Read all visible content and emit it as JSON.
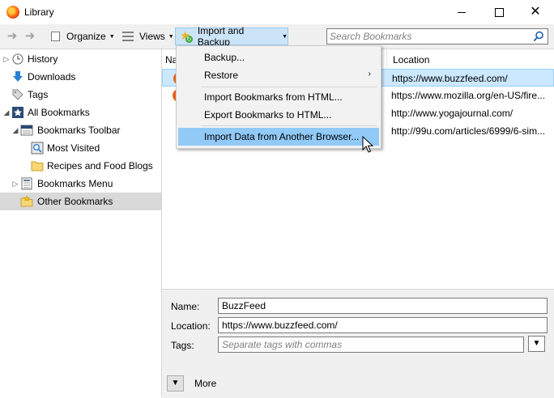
{
  "window": {
    "title": "Library"
  },
  "toolbar": {
    "organize_label": "Organize",
    "views_label": "Views",
    "import_backup_label": "Import and Backup",
    "search_placeholder": "Search Bookmarks"
  },
  "sidebar": {
    "items": [
      {
        "label": "History",
        "icon": "history-icon"
      },
      {
        "label": "Downloads",
        "icon": "downloads-icon"
      },
      {
        "label": "Tags",
        "icon": "tags-icon"
      },
      {
        "label": "All Bookmarks",
        "icon": "all-bookmarks-icon"
      },
      {
        "label": "Bookmarks Toolbar",
        "icon": "bookmarks-toolbar-icon"
      },
      {
        "label": "Most Visited",
        "icon": "smart-folder-icon"
      },
      {
        "label": "Recipes and Food Blogs",
        "icon": "folder-icon"
      },
      {
        "label": "Bookmarks Menu",
        "icon": "bookmarks-menu-icon"
      },
      {
        "label": "Other Bookmarks",
        "icon": "other-bookmarks-icon"
      }
    ],
    "selected": "Other Bookmarks"
  },
  "list": {
    "columns": [
      "Na",
      "Location"
    ],
    "rows": [
      {
        "location": "https://www.buzzfeed.com/"
      },
      {
        "location": "https://www.mozilla.org/en-US/fire..."
      },
      {
        "location": "http://www.yogajournal.com/"
      },
      {
        "location": "http://99u.com/articles/6999/6-sim..."
      }
    ]
  },
  "menu": {
    "items": [
      {
        "label": "Backup...",
        "accel": "B"
      },
      {
        "label": "Restore",
        "accel": "R"
      },
      {
        "label": "Import Bookmarks from HTML...",
        "accel": "I"
      },
      {
        "label": "Export Bookmarks to HTML...",
        "accel": "E"
      },
      {
        "label": "Import Data from Another Browser...",
        "accel": "A"
      }
    ]
  },
  "details": {
    "name_label": "Name:",
    "name_value": "BuzzFeed",
    "location_label": "Location:",
    "location_value": "https://www.buzzfeed.com/",
    "tags_label": "Tags:",
    "tags_placeholder": "Separate tags with commas",
    "more_label": "More"
  },
  "colors": {
    "selection": "#cce8ff",
    "menu_hover": "#91c9f7",
    "toolbar_bg": "#f0f0f0"
  }
}
